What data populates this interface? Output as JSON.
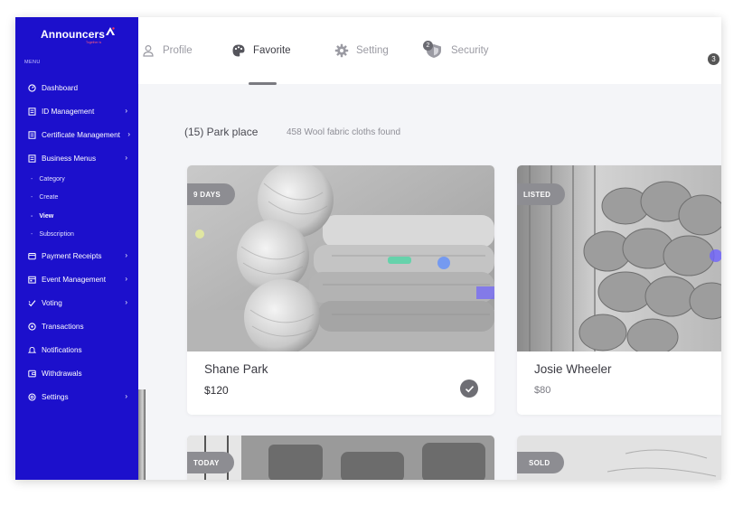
{
  "brand": {
    "name": "Announcers",
    "tagline": "Together is"
  },
  "sidebar": {
    "menu_heading": "MENU",
    "items": [
      {
        "label": "Dashboard",
        "icon": "dashboard-icon",
        "chevron": false
      },
      {
        "label": "ID Management",
        "icon": "document-icon",
        "chevron": true
      },
      {
        "label": "Certificate Management",
        "icon": "document-icon",
        "chevron": true
      },
      {
        "label": "Business Menus",
        "icon": "document-icon",
        "chevron": true
      }
    ],
    "sub_items": [
      {
        "label": "Category",
        "active": false
      },
      {
        "label": "Create",
        "active": false
      },
      {
        "label": "View",
        "active": true
      },
      {
        "label": "Subscription",
        "active": false
      }
    ],
    "items_after": [
      {
        "label": "Payment Receipts",
        "icon": "receipt-icon",
        "chevron": true
      },
      {
        "label": "Event Management",
        "icon": "calendar-icon",
        "chevron": true
      },
      {
        "label": "Voting",
        "icon": "voting-icon",
        "chevron": true
      },
      {
        "label": "Transactions",
        "icon": "transactions-icon",
        "chevron": false
      },
      {
        "label": "Notifications",
        "icon": "bell-icon",
        "chevron": false
      },
      {
        "label": "Withdrawals",
        "icon": "wallet-icon",
        "chevron": false
      },
      {
        "label": "Settings",
        "icon": "settings-icon",
        "chevron": true
      }
    ],
    "chevron_glyph": "›"
  },
  "tabs": [
    {
      "label": "Profile",
      "icon": "user-icon",
      "active": false
    },
    {
      "label": "Favorite",
      "icon": "palette-icon",
      "active": true
    },
    {
      "label": "Setting",
      "icon": "gear-icon",
      "active": false
    },
    {
      "label": "Security",
      "icon": "shield-icon",
      "active": false,
      "badge": "2"
    }
  ],
  "top_badge": "3",
  "listing": {
    "title": "(15) Park place",
    "subtitle": "458 Wool fabric cloths found"
  },
  "cards": [
    {
      "tag": "9 DAYS",
      "name": "Shane Park",
      "price": "$120",
      "checked": true
    },
    {
      "tag": "LISTED",
      "name": "Josie Wheeler",
      "price": "$80",
      "checked": false
    },
    {
      "tag": "TODAY",
      "name": "",
      "price": "",
      "checked": false
    },
    {
      "tag": "SOLD",
      "name": "",
      "price": "",
      "checked": false
    }
  ],
  "colors": {
    "sidebar": "#1c10cc",
    "pill": "#8d8d92",
    "background": "#f4f5f8"
  }
}
